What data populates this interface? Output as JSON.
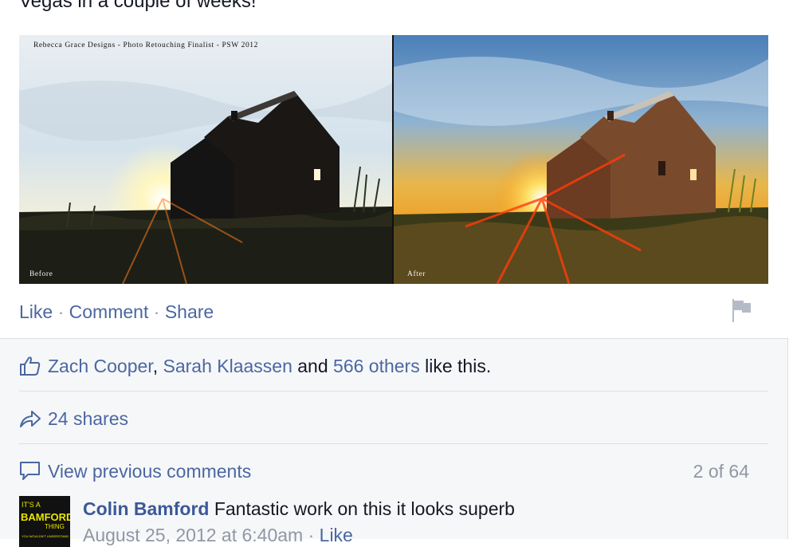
{
  "post": {
    "text": "Vegas in a couple of weeks!",
    "photo": {
      "caption": "Rebecca Grace Designs - Photo Retouching Finalist - PSW 2012",
      "before_label": "Before",
      "after_label": "After"
    }
  },
  "actions": {
    "like": "Like",
    "comment": "Comment",
    "share": "Share",
    "separator": "·",
    "flag_icon": "flag-icon"
  },
  "likes": {
    "icon": "thumbs-up-icon",
    "name1": "Zach Cooper",
    "comma": ",",
    "name2": "Sarah Klaassen",
    "and": "and",
    "others": "566 others",
    "suffix": "like this."
  },
  "shares": {
    "icon": "share-arrow-icon",
    "label": "24 shares"
  },
  "comments": {
    "icon": "speech-bubble-icon",
    "view_previous": "View previous comments",
    "count": "2 of 64",
    "items": [
      {
        "author": "Colin Bamford",
        "text": "Fantastic work on this it looks superb",
        "time": "August 25, 2012 at 6:40am",
        "separator": "·",
        "like": "Like",
        "avatar": {
          "line1": "IT'S A",
          "line2": "BAMFORD",
          "line3": "THING",
          "line4": "YOU WOULDN'T UNDERSTAND"
        }
      }
    ]
  },
  "colors": {
    "link": "#4b67a1",
    "author": "#3b5998",
    "muted": "#9197a3",
    "feedback_bg": "#f6f7f9",
    "divider": "#dddfe2"
  }
}
